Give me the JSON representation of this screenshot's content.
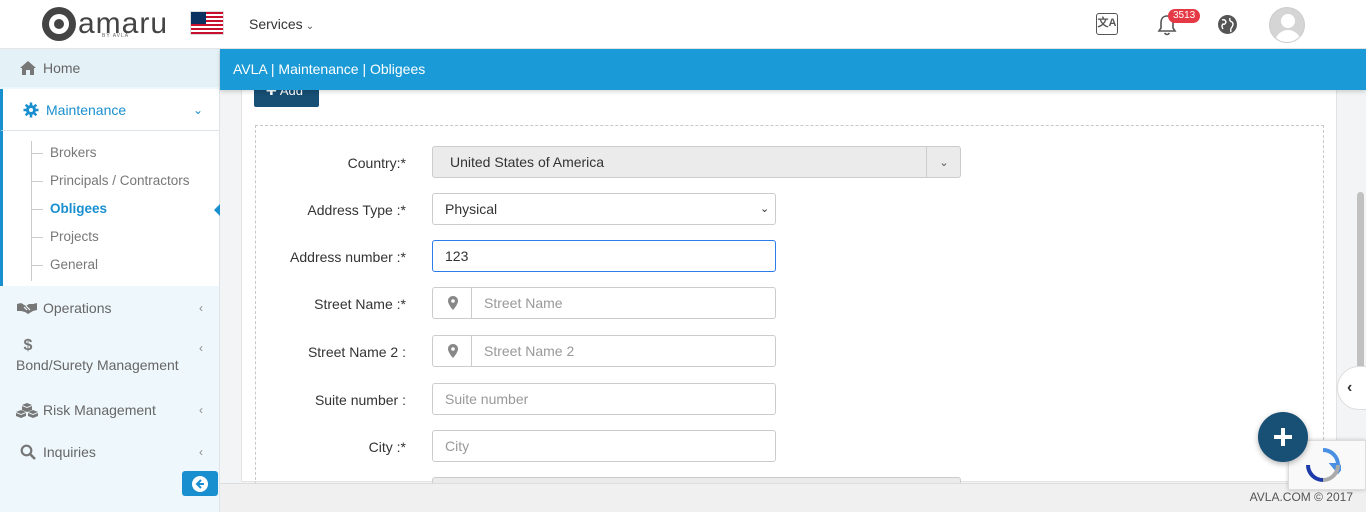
{
  "header": {
    "logo_text": "amaru",
    "logo_sub": "BY AVLA",
    "services_label": "Services",
    "notification_count": "3513"
  },
  "sidebar": {
    "home": "Home",
    "maintenance": "Maintenance",
    "submenu": [
      "Brokers",
      "Principals / Contractors",
      "Obligees",
      "Projects",
      "General"
    ],
    "active_submenu": "Obligees",
    "operations": "Operations",
    "bond_surety": "Bond/Surety Management",
    "risk": "Risk Management",
    "inquiries": "Inquiries"
  },
  "breadcrumb": "AVLA | Maintenance | Obligees",
  "toolbar": {
    "add_label": "Add"
  },
  "form": {
    "country_label": "Country:*",
    "country_value": "United States of America",
    "address_type_label": "Address Type :*",
    "address_type_value": "Physical",
    "address_number_label": "Address number :*",
    "address_number_value": "123",
    "street_name_label": "Street Name :*",
    "street_name_placeholder": "Street Name",
    "street_name2_label": "Street Name 2 :",
    "street_name2_placeholder": "Street Name 2",
    "suite_label": "Suite number :",
    "suite_placeholder": "Suite number",
    "city_label": "City :*",
    "city_placeholder": "City"
  },
  "footer": "AVLA.COM © 2017",
  "colors": {
    "primary": "#1a9ad6",
    "accent": "#1a8fd0",
    "dark": "#174f75"
  }
}
